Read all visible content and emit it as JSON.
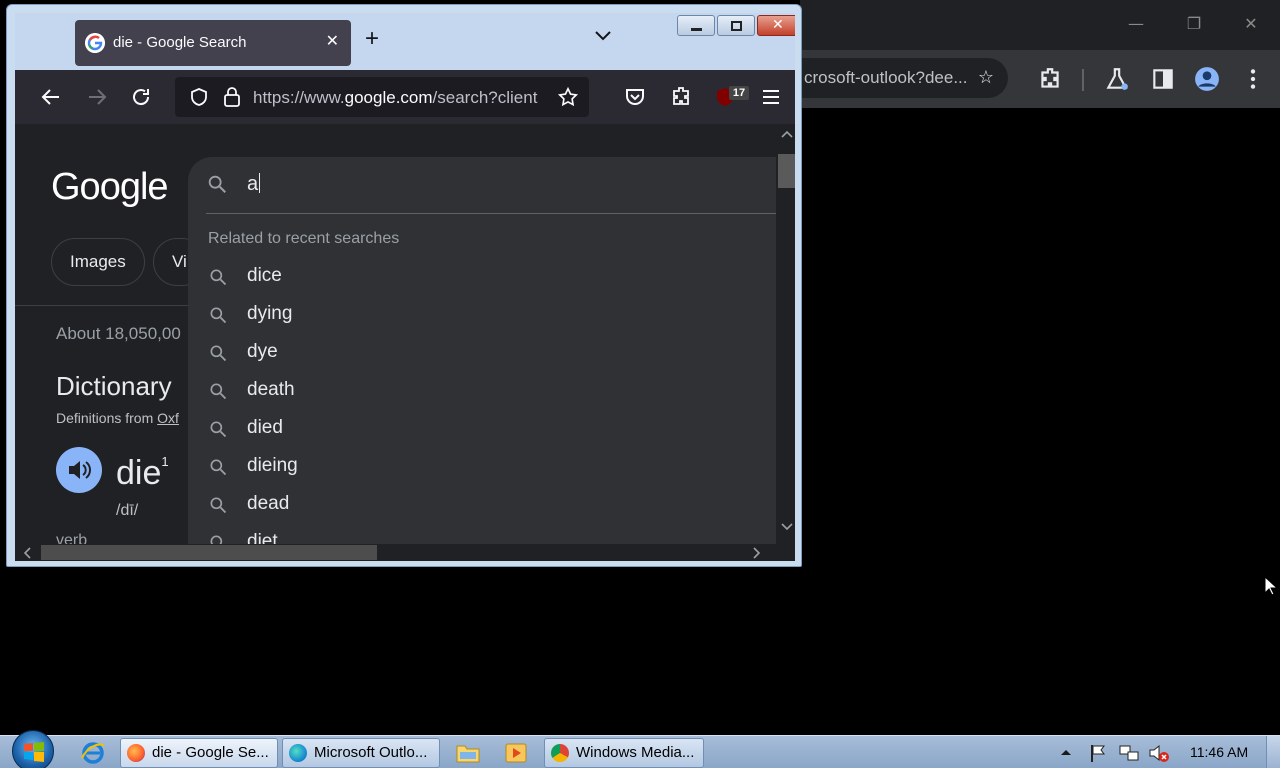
{
  "background_chrome": {
    "omnibox_text": "crosoft-outlook?dee...",
    "window_controls": [
      "minimize-icon",
      "restore-icon",
      "close-icon"
    ],
    "toolbar_icons": [
      "star-icon",
      "extensions-icon",
      "labs-icon",
      "side-panel-icon",
      "profile-icon",
      "kebab-menu-icon"
    ]
  },
  "firefox": {
    "tab": {
      "title": "die - Google Search",
      "favicon": "google-icon",
      "close_glyph": "✕"
    },
    "new_tab_glyph": "+",
    "url": {
      "prefix": "https://www.",
      "domain": "google.com",
      "suffix": "/search?client"
    },
    "ublock_count": "17"
  },
  "google": {
    "logo": "Google",
    "chips": [
      "Images",
      "Vi"
    ],
    "stats": "About 18,050,00",
    "dictionary_title": "Dictionary",
    "definitions_from": "Definitions from",
    "definitions_source": "Oxf",
    "word": "die",
    "word_sup": "1",
    "pronunciation": "/dī/",
    "part_of_speech": "verb",
    "search_query": "a",
    "related_label": "Related to recent searches",
    "suggestions": [
      "dice",
      "dying",
      "dye",
      "death",
      "died",
      "dieing",
      "dead",
      "diet"
    ]
  },
  "taskbar": {
    "buttons": [
      {
        "label": "die - Google Se...",
        "icon": "firefox-icon"
      },
      {
        "label": "Microsoft Outlo...",
        "icon": "edge-icon"
      },
      {
        "label": "Windows Media...",
        "icon": "chrome-icon"
      }
    ],
    "time": "11:46 AM"
  },
  "colors": {
    "dark_bg": "#202124",
    "suggest_bg": "#303134",
    "firefox_tab": "#42414d",
    "aero_frame": "#c9dcf0"
  }
}
